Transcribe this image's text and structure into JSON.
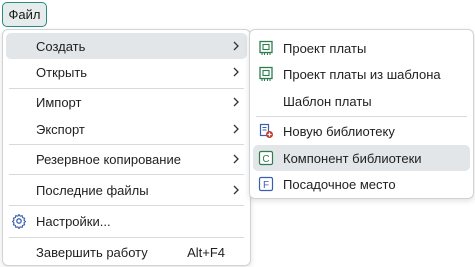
{
  "menubar": {
    "file_label": "Файл"
  },
  "file_menu": {
    "create": "Создать",
    "open": "Открыть",
    "import": "Импорт",
    "export": "Экспорт",
    "backup": "Резервное копирование",
    "recent": "Последние файлы",
    "settings": "Настройки...",
    "exit": "Завершить работу",
    "exit_shortcut": "Alt+F4",
    "highlighted": "Создать"
  },
  "create_submenu": {
    "board_project": "Проект платы",
    "board_from_template": "Проект платы из шаблона",
    "board_template": "Шаблон платы",
    "new_library": "Новую библиотеку",
    "library_component": "Компонент библиотеки",
    "footprint": "Посадочное место",
    "highlighted": "Компонент библиотеки"
  },
  "colors": {
    "accent": "#2a8a82",
    "icon_green": "#2e7d4f",
    "icon_blue": "#3a5fb0",
    "icon_red": "#c0392b",
    "highlight": "#e2e6e8"
  }
}
